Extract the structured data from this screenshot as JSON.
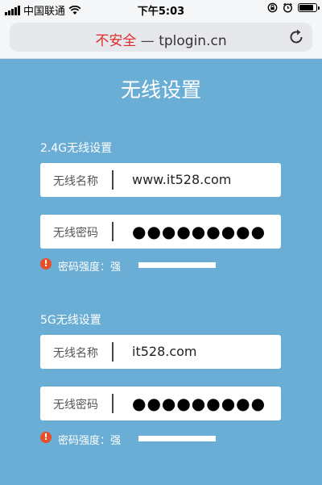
{
  "status_bar": {
    "carrier": "中国联通",
    "time": "下午5:03",
    "icons": [
      "signal-icon",
      "wifi-icon",
      "rotation-lock-icon",
      "alarm-icon",
      "battery-icon"
    ]
  },
  "browser": {
    "insecure_label": "不安全",
    "separator": "—",
    "url": "tplogin.cn"
  },
  "page": {
    "title": "无线设置",
    "sections": [
      {
        "heading": "2.4G无线设置",
        "name_label": "无线名称",
        "name_value": "www.it528.com",
        "password_label": "无线密码",
        "password_value": "●●●●●●●●●",
        "strength_label": "密码强度：强",
        "strength_level": 1.0
      },
      {
        "heading": "5G无线设置",
        "name_label": "无线名称",
        "name_value": "it528.com",
        "password_label": "无线密码",
        "password_value": "●●●●●●●●●",
        "strength_label": "密码强度：强",
        "strength_level": 1.0
      }
    ]
  },
  "colors": {
    "background": "#6aaed6",
    "insecure": "#e02b2b",
    "warning": "#e5502b"
  }
}
